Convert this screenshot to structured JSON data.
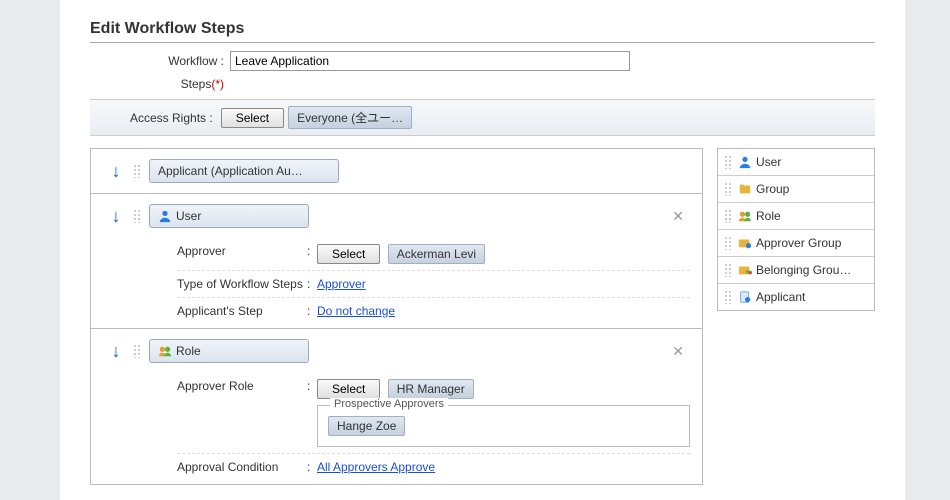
{
  "title": "Edit Workflow Steps",
  "workflow_label": "Workflow :",
  "workflow_value": "Leave Application",
  "steps_label": "Steps",
  "steps_req": "(*)",
  "access_label": "Access Rights :",
  "select_btn": "Select",
  "access_tag": "Everyone (全ユー…",
  "step0_label": "Applicant (Application Au…",
  "step1_label": "User",
  "step1": {
    "approver_lbl": "Approver",
    "approver_tag": "Ackerman Levi",
    "type_lbl": "Type of Workflow Steps",
    "type_val": "Approver",
    "appstep_lbl": "Applicant's Step",
    "appstep_val": "Do not change"
  },
  "step2_label": "Role",
  "step2": {
    "role_lbl": "Approver Role",
    "role_tag": "HR Manager",
    "prospective_lbl": "Prospective Approvers",
    "prospective_tag": "Hange Zoe",
    "cond_lbl": "Approval Condition",
    "cond_val": "All Approvers Approve"
  },
  "palette": {
    "user": "User",
    "group": "Group",
    "role": "Role",
    "approver_group": "Approver Group",
    "belonging_group": "Belonging Grou…",
    "applicant": "Applicant"
  }
}
